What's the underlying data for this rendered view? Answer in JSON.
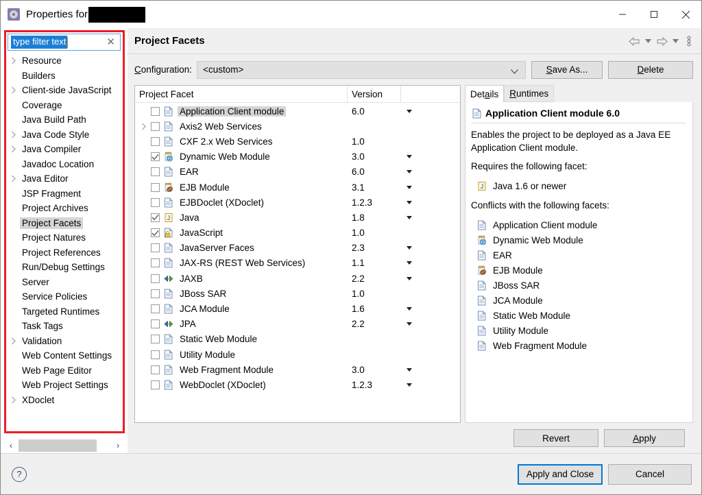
{
  "window": {
    "title_prefix": "Properties for",
    "app_icon": "eclipse-properties-icon",
    "minimize_label": "—",
    "maximize_label": "□",
    "close_label": "✕"
  },
  "sidebar": {
    "filter": {
      "value": "type filter text",
      "clear_label": "✕"
    },
    "items": [
      {
        "label": "Resource",
        "expandable": true,
        "selected": false
      },
      {
        "label": "Builders",
        "expandable": false,
        "selected": false
      },
      {
        "label": "Client-side JavaScript",
        "expandable": true,
        "selected": false
      },
      {
        "label": "Coverage",
        "expandable": false,
        "selected": false
      },
      {
        "label": "Java Build Path",
        "expandable": false,
        "selected": false
      },
      {
        "label": "Java Code Style",
        "expandable": true,
        "selected": false
      },
      {
        "label": "Java Compiler",
        "expandable": true,
        "selected": false
      },
      {
        "label": "Javadoc Location",
        "expandable": false,
        "selected": false
      },
      {
        "label": "Java Editor",
        "expandable": true,
        "selected": false
      },
      {
        "label": "JSP Fragment",
        "expandable": false,
        "selected": false
      },
      {
        "label": "Project Archives",
        "expandable": false,
        "selected": false
      },
      {
        "label": "Project Facets",
        "expandable": false,
        "selected": true
      },
      {
        "label": "Project Natures",
        "expandable": false,
        "selected": false
      },
      {
        "label": "Project References",
        "expandable": false,
        "selected": false
      },
      {
        "label": "Run/Debug Settings",
        "expandable": false,
        "selected": false
      },
      {
        "label": "Server",
        "expandable": false,
        "selected": false
      },
      {
        "label": "Service Policies",
        "expandable": false,
        "selected": false
      },
      {
        "label": "Targeted Runtimes",
        "expandable": false,
        "selected": false
      },
      {
        "label": "Task Tags",
        "expandable": false,
        "selected": false
      },
      {
        "label": "Validation",
        "expandable": true,
        "selected": false
      },
      {
        "label": "Web Content Settings",
        "expandable": false,
        "selected": false
      },
      {
        "label": "Web Page Editor",
        "expandable": false,
        "selected": false
      },
      {
        "label": "Web Project Settings",
        "expandable": false,
        "selected": false
      },
      {
        "label": "XDoclet",
        "expandable": true,
        "selected": false
      }
    ],
    "scroll_left_label": "‹",
    "scroll_right_label": "›"
  },
  "page": {
    "title": "Project Facets",
    "nav": {
      "back_icon": "back-arrow-icon",
      "back_menu_icon": "chevron-down-icon",
      "forward_icon": "forward-arrow-icon",
      "forward_menu_icon": "chevron-down-icon",
      "menu_icon": "view-menu-icon"
    }
  },
  "configuration": {
    "label": "Configuration:",
    "value": "<custom>",
    "save_as_label": "Save As...",
    "save_as_mnemonic": "S",
    "delete_label": "Delete",
    "delete_mnemonic": "D"
  },
  "facet_table": {
    "headers": {
      "facet": "Project Facet",
      "version": "Version",
      "spacer": ""
    },
    "rows": [
      {
        "name": "Application Client module",
        "version": "6.0",
        "checked": false,
        "selected": true,
        "expandable": false,
        "has_version_menu": true,
        "icon": "document-icon"
      },
      {
        "name": "Axis2 Web Services",
        "version": "",
        "checked": false,
        "selected": false,
        "expandable": true,
        "has_version_menu": false,
        "icon": "document-icon"
      },
      {
        "name": "CXF 2.x Web Services",
        "version": "1.0",
        "checked": false,
        "selected": false,
        "expandable": false,
        "has_version_menu": false,
        "icon": "document-icon"
      },
      {
        "name": "Dynamic Web Module",
        "version": "3.0",
        "checked": true,
        "selected": false,
        "expandable": false,
        "has_version_menu": true,
        "icon": "web-module-icon"
      },
      {
        "name": "EAR",
        "version": "6.0",
        "checked": false,
        "selected": false,
        "expandable": false,
        "has_version_menu": true,
        "icon": "document-icon"
      },
      {
        "name": "EJB Module",
        "version": "3.1",
        "checked": false,
        "selected": false,
        "expandable": false,
        "has_version_menu": true,
        "icon": "ejb-bean-icon"
      },
      {
        "name": "EJBDoclet (XDoclet)",
        "version": "1.2.3",
        "checked": false,
        "selected": false,
        "expandable": false,
        "has_version_menu": true,
        "icon": "document-icon"
      },
      {
        "name": "Java",
        "version": "1.8",
        "checked": true,
        "selected": false,
        "expandable": false,
        "has_version_menu": true,
        "icon": "java-icon"
      },
      {
        "name": "JavaScript",
        "version": "1.0",
        "checked": true,
        "selected": false,
        "expandable": false,
        "has_version_menu": false,
        "icon": "javascript-lock-icon"
      },
      {
        "name": "JavaServer Faces",
        "version": "2.3",
        "checked": false,
        "selected": false,
        "expandable": false,
        "has_version_menu": true,
        "icon": "document-icon"
      },
      {
        "name": "JAX-RS (REST Web Services)",
        "version": "1.1",
        "checked": false,
        "selected": false,
        "expandable": false,
        "has_version_menu": true,
        "icon": "document-icon"
      },
      {
        "name": "JAXB",
        "version": "2.2",
        "checked": false,
        "selected": false,
        "expandable": false,
        "has_version_menu": true,
        "icon": "binding-arrows-icon"
      },
      {
        "name": "JBoss SAR",
        "version": "1.0",
        "checked": false,
        "selected": false,
        "expandable": false,
        "has_version_menu": false,
        "icon": "document-icon"
      },
      {
        "name": "JCA Module",
        "version": "1.6",
        "checked": false,
        "selected": false,
        "expandable": false,
        "has_version_menu": true,
        "icon": "document-icon"
      },
      {
        "name": "JPA",
        "version": "2.2",
        "checked": false,
        "selected": false,
        "expandable": false,
        "has_version_menu": true,
        "icon": "binding-arrows-icon"
      },
      {
        "name": "Static Web Module",
        "version": "",
        "checked": false,
        "selected": false,
        "expandable": false,
        "has_version_menu": false,
        "icon": "document-icon"
      },
      {
        "name": "Utility Module",
        "version": "",
        "checked": false,
        "selected": false,
        "expandable": false,
        "has_version_menu": false,
        "icon": "document-icon"
      },
      {
        "name": "Web Fragment Module",
        "version": "3.0",
        "checked": false,
        "selected": false,
        "expandable": false,
        "has_version_menu": true,
        "icon": "document-icon"
      },
      {
        "name": "WebDoclet (XDoclet)",
        "version": "1.2.3",
        "checked": false,
        "selected": false,
        "expandable": false,
        "has_version_menu": true,
        "icon": "document-icon"
      }
    ]
  },
  "details": {
    "tabs": [
      {
        "label": "Details",
        "mnemonic": "a",
        "active": true
      },
      {
        "label": "Runtimes",
        "mnemonic": "R",
        "active": false
      }
    ],
    "heading": "Application Client module 6.0",
    "heading_icon": "document-icon",
    "description": "Enables the project to be deployed as a Java EE Application Client module.",
    "requires_label": "Requires the following facet:",
    "requires": [
      {
        "label": "Java 1.6 or newer",
        "icon": "java-icon"
      }
    ],
    "conflicts_label": "Conflicts with the following facets:",
    "conflicts": [
      {
        "label": "Application Client module",
        "icon": "document-icon"
      },
      {
        "label": "Dynamic Web Module",
        "icon": "web-module-icon"
      },
      {
        "label": "EAR",
        "icon": "document-icon"
      },
      {
        "label": "EJB Module",
        "icon": "ejb-bean-icon"
      },
      {
        "label": "JBoss SAR",
        "icon": "document-icon"
      },
      {
        "label": "JCA Module",
        "icon": "document-icon"
      },
      {
        "label": "Static Web Module",
        "icon": "document-icon"
      },
      {
        "label": "Utility Module",
        "icon": "document-icon"
      },
      {
        "label": "Web Fragment Module",
        "icon": "document-icon"
      }
    ]
  },
  "actions": {
    "revert_label": "Revert",
    "apply_label": "Apply",
    "apply_mnemonic": "A"
  },
  "footer": {
    "help_label": "?",
    "apply_and_close_label": "Apply and Close",
    "cancel_label": "Cancel"
  },
  "colors": {
    "accent_focus": "#0078d7",
    "selection_blue": "#1c7fd6",
    "highlight_red": "#ee1c25",
    "panel_bg": "#f0f0f0"
  }
}
